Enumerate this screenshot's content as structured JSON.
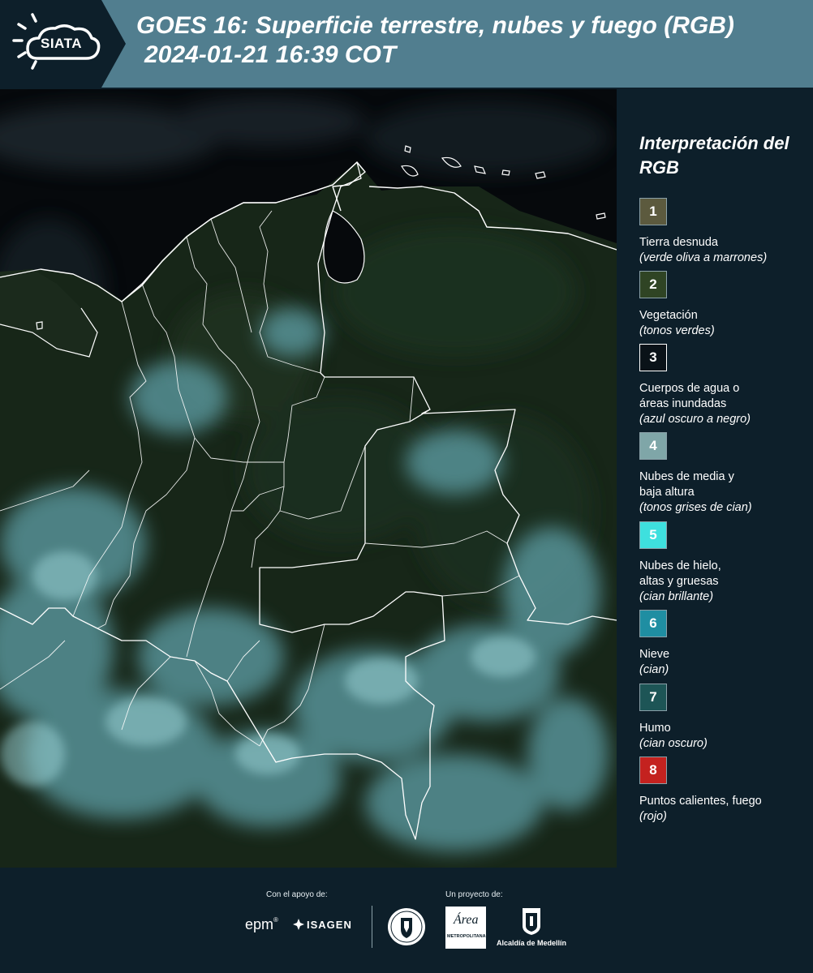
{
  "header": {
    "logo_text": "SIATA",
    "title_line1": "GOES 16: Superficie terrestre, nubes y fuego (RGB)",
    "title_line2": "2024-01-21 16:39 COT"
  },
  "legend": {
    "title": "Interpretación del RGB",
    "items": [
      {
        "number": "1",
        "label": "Tierra desnuda",
        "note": "(verde oliva a marrones)",
        "color": "#5c5a3e"
      },
      {
        "number": "2",
        "label": "Vegetación",
        "note": "(tonos verdes)",
        "color": "#2f4424"
      },
      {
        "number": "3",
        "label": "Cuerpos de agua o\náreas inundadas",
        "note": "(azul oscuro a negro)",
        "color": "#0a1218"
      },
      {
        "number": "4",
        "label": "Nubes de media y\nbaja altura",
        "note": "(tonos grises de cian)",
        "color": "#7fa6a8"
      },
      {
        "number": "5",
        "label": "Nubes de hielo,\naltas y gruesas",
        "note": "(cian brillante)",
        "color": "#3ee0de"
      },
      {
        "number": "6",
        "label": "Nieve",
        "note": "(cian)",
        "color": "#1f8ea2"
      },
      {
        "number": "7",
        "label": "Humo",
        "note": "(cian oscuro)",
        "color": "#1d5556"
      },
      {
        "number": "8",
        "label": "Puntos calientes, fuego",
        "note": "(rojo)",
        "color": "#c4221f"
      }
    ]
  },
  "footer": {
    "support_caption": "Con el apoyo de:",
    "project_caption": "Un proyecto de:",
    "epm": "epm",
    "isagen": "ISAGEN",
    "metropolitana_line1": "Área",
    "metropolitana_line2": "METROPOLITANA",
    "alcaldia": "Alcaldía de Medellín"
  },
  "colors": {
    "header_bg": "#517e8f",
    "logo_bg": "#0d1f2a",
    "panel_bg": "#0d1f2a",
    "map_ocean": "#06090c",
    "map_land": "#1a2a1c",
    "boundary": "#ffffff",
    "cloud": "#6fb3bb"
  }
}
